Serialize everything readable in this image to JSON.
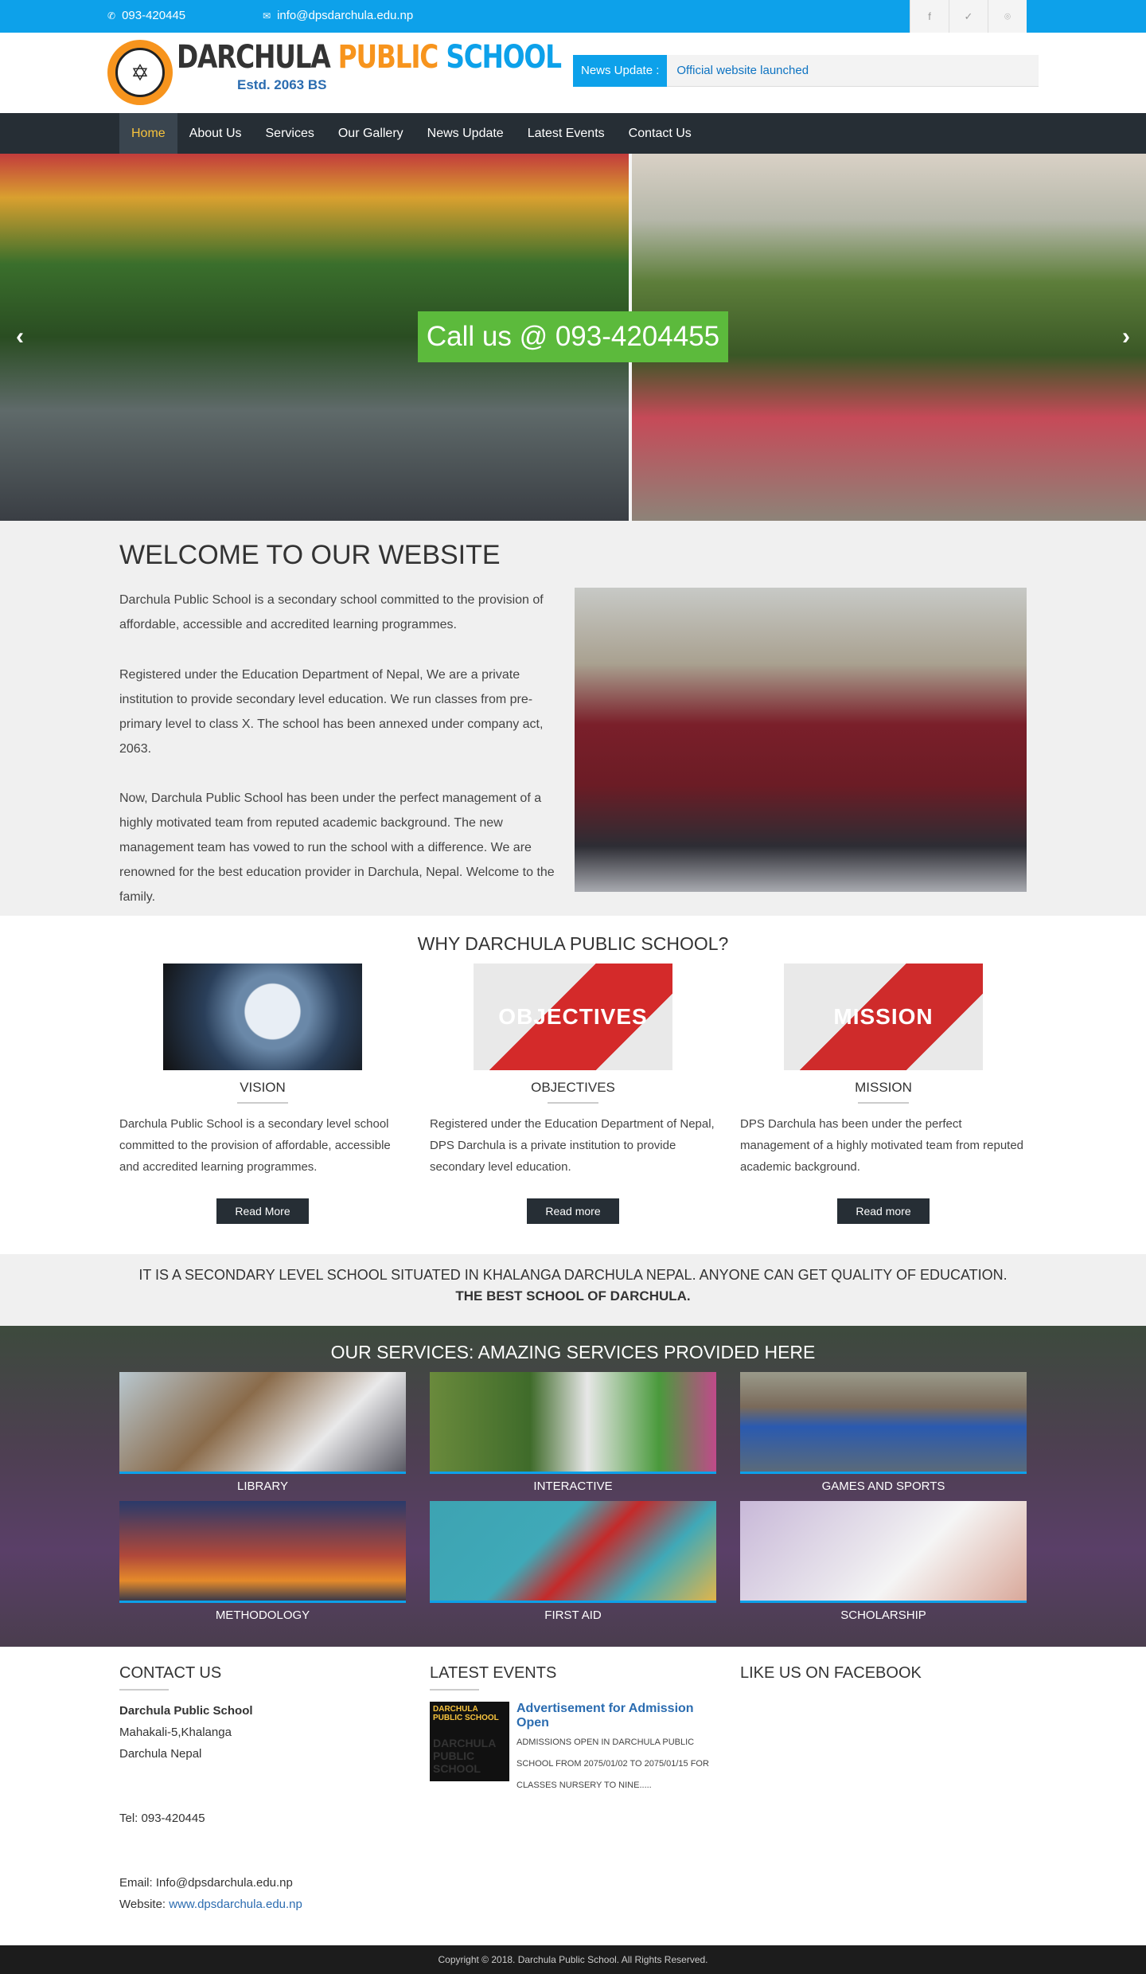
{
  "topbar": {
    "phone": "093-420445",
    "email": "info@dpsdarchula.edu.np",
    "social": [
      "f",
      "✓",
      "⌾"
    ]
  },
  "header": {
    "logo_title_a": "DARCHULA ",
    "logo_title_b": "PUBLIC ",
    "logo_title_c": "SCHOOL",
    "logo_sub": "Estd. 2063 BS",
    "news_label": "News Update :",
    "news_text": "Official website launched"
  },
  "nav": [
    "Home",
    "About Us",
    "Services",
    "Our Gallery",
    "News Update",
    "Latest Events",
    "Contact Us"
  ],
  "slider": {
    "call": "Call us @ 093-4204455",
    "prev": "‹",
    "next": "›"
  },
  "welcome": {
    "title": "WELCOME TO OUR WEBSITE",
    "p1": "Darchula Public School is a secondary school committed to the provision of affordable, accessible and accredited learning programmes.",
    "p2": "Registered under the Education Department of Nepal, We are a private institution to provide secondary level education. We run classes from pre-primary level to class X. The school has been annexed under company act, 2063.",
    "p3": "Now, Darchula Public School has been under the perfect management of a highly motivated team from reputed academic background. The new management team has vowed to run the school with a difference. We are renowned for the best education provider in Darchula, Nepal. Welcome to the family."
  },
  "why": {
    "title": "WHY DARCHULA PUBLIC SCHOOL?",
    "cols": [
      {
        "heading": "VISION",
        "image_text": "",
        "text": "Darchula Public School is a secondary level school committed to the provision of affordable, accessible and accredited learning programmes.",
        "button": "Read More"
      },
      {
        "heading": "OBJECTIVES",
        "image_text": "OBJECTIVES",
        "text": "Registered under the Education Department of Nepal, DPS Darchula is a private institution to provide secondary level education.",
        "button": "Read more"
      },
      {
        "heading": "MISSION",
        "image_text": "MISSION",
        "text": "DPS Darchula has been under the perfect management of a highly motivated team from reputed academic background.",
        "button": "Read more"
      }
    ]
  },
  "banner": {
    "line1": "IT IS A SECONDARY LEVEL SCHOOL SITUATED IN KHALANGA DARCHULA NEPAL. ANYONE CAN GET QUALITY OF EDUCATION.",
    "line2": "THE BEST SCHOOL OF DARCHULA."
  },
  "services": {
    "title": "OUR SERVICES: AMAZING SERVICES PROVIDED HERE",
    "items": [
      "LIBRARY",
      "INTERACTIVE",
      "GAMES AND SPORTS",
      "METHODOLOGY",
      "FIRST AID",
      "SCHOLARSHIP"
    ]
  },
  "contact": {
    "title": "CONTACT US",
    "name": "Darchula Public School",
    "addr1": "Mahakali-5,Khalanga",
    "addr2": "Darchula Nepal",
    "tel": "Tel: 093-420445",
    "email": "Email: Info@dpsdarchula.edu.np",
    "website_label": "Website: ",
    "website": "www.dpsdarchula.edu.np"
  },
  "events": {
    "title": "LATEST EVENTS",
    "thumb_line": "DARCHULA PUBLIC SCHOOL",
    "item_title": "Advertisement for Admission Open",
    "item_desc": "ADMISSIONS OPEN IN DARCHULA PUBLIC SCHOOL FROM 2075/01/02 TO 2075/01/15 FOR CLASSES NURSERY TO NINE....."
  },
  "facebook": {
    "title": "LIKE US ON FACEBOOK"
  },
  "footer": {
    "copyright": "Copyright © 2018. Darchula Public School. All Rights Reserved."
  },
  "colors": {
    "accent": "#0da1ea",
    "nav": "#262e35",
    "call": "#5cba3c",
    "highlight": "#f7c33d"
  }
}
